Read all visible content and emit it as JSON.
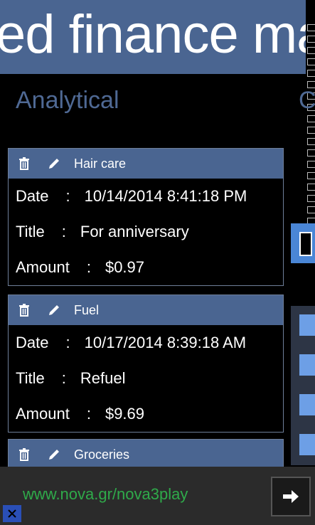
{
  "header": {
    "title": "ed finance ma"
  },
  "section": {
    "title": "Analytical",
    "next_peek": "C"
  },
  "expenses": [
    {
      "category": "Hair care",
      "date_label": "Date",
      "date_value": "10/14/2014 8:41:18 PM",
      "title_label": "Title",
      "title_value": "For anniversary",
      "amount_label": "Amount",
      "amount_value": "$0.97"
    },
    {
      "category": "Fuel",
      "date_label": "Date",
      "date_value": "10/17/2014 8:39:18 AM",
      "title_label": "Title",
      "title_value": "Refuel",
      "amount_label": "Amount",
      "amount_value": "$9.69"
    },
    {
      "category": "Groceries"
    }
  ],
  "separator": ":",
  "ad": {
    "url": "www.nova.gr/nova3play"
  },
  "colors": {
    "accent": "#4a6591",
    "ad_text": "#2faa4a"
  }
}
